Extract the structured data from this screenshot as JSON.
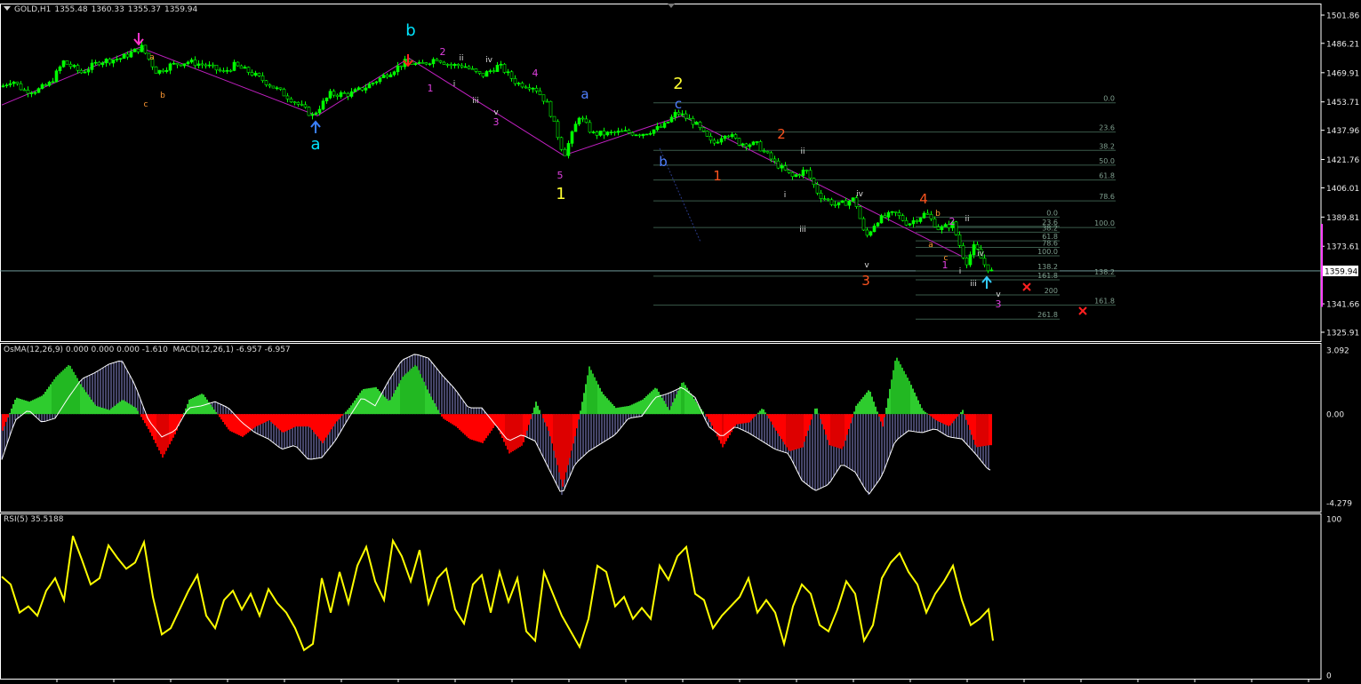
{
  "colors": {
    "background": "#000000",
    "grid_frame": "#ffffff",
    "candle_bull": "#00ff00",
    "candle_bear": "#00ff00",
    "fib_line": "#3a5a4a",
    "fib_text": "#7f9f8f",
    "macd_signal": "#ffffff",
    "histogram_hatch": "#8a8ad0",
    "osma_pos": "#2ecc2e",
    "osma_neg": "#ff0000",
    "rsi_line": "#ffff00",
    "wave_line": "#c020c0"
  },
  "header": {
    "symbol": "GOLD,H1",
    "open": "1355.48",
    "high": "1360.33",
    "low": "1355.37",
    "close": "1359.94"
  },
  "chart_data": [
    {
      "type": "candlestick",
      "title": "GOLD,H1",
      "ylim": [
        1325.91,
        1501.86
      ],
      "y_ticks": [
        "1501.86",
        "1486.21",
        "1469.91",
        "1453.71",
        "1437.96",
        "1421.76",
        "1406.01",
        "1389.81",
        "1373.61",
        "1359.94",
        "1341.66",
        "1325.91"
      ],
      "current_price": "1359.94",
      "price_path_x_index": [
        0,
        12,
        25,
        40,
        55,
        70,
        90,
        110,
        135,
        158,
        175,
        190,
        210,
        230,
        250,
        262,
        280,
        300,
        330,
        350,
        370,
        392,
        410,
        430,
        455,
        470,
        490,
        505,
        520,
        540,
        560,
        580,
        600,
        615,
        633,
        650,
        665,
        680,
        700,
        720,
        745,
        760,
        780,
        800,
        815,
        830,
        850,
        870,
        890,
        905,
        920,
        940,
        960,
        972,
        985,
        1005,
        1020,
        1040,
        1055,
        1070,
        1085,
        1095,
        1105,
        1115
      ],
      "price_path": [
        1462,
        1466,
        1460,
        1460,
        1464,
        1476,
        1470,
        1476,
        1478,
        1484,
        1470,
        1474,
        1476,
        1474,
        1470,
        1474,
        1470,
        1464,
        1454,
        1446,
        1458,
        1458,
        1462,
        1468,
        1476,
        1474,
        1478,
        1474,
        1474,
        1468,
        1474,
        1464,
        1462,
        1452,
        1424,
        1446,
        1436,
        1436,
        1437,
        1436,
        1440,
        1448,
        1442,
        1430,
        1437,
        1431,
        1430,
        1420,
        1412,
        1416,
        1402,
        1396,
        1400,
        1378,
        1388,
        1392,
        1386,
        1392,
        1383,
        1386,
        1364,
        1374,
        1364,
        1359
      ],
      "elliott_labels": [
        {
          "text": "a",
          "color": "#00e5ff",
          "size": "big"
        },
        {
          "text": "b",
          "color": "#00e5ff",
          "size": "big"
        },
        {
          "text": "1",
          "color": "#ffff33",
          "size": "big"
        },
        {
          "text": "2",
          "color": "#ffff33",
          "size": "big"
        },
        {
          "text": "a",
          "color": "#4f7fff",
          "size": "mid"
        },
        {
          "text": "b",
          "color": "#4f7fff",
          "size": "mid"
        },
        {
          "text": "c",
          "color": "#4f7fff",
          "size": "mid"
        },
        {
          "text": "1",
          "color": "#ff5520",
          "size": "mid"
        },
        {
          "text": "2",
          "color": "#ff5520",
          "size": "mid"
        },
        {
          "text": "3",
          "color": "#ff5520",
          "size": "mid"
        },
        {
          "text": "4",
          "color": "#ff5520",
          "size": "mid"
        },
        {
          "text": "1",
          "color": "#e040e0",
          "size": "small"
        },
        {
          "text": "2",
          "color": "#e040e0",
          "size": "small"
        },
        {
          "text": "3",
          "color": "#e040e0",
          "size": "small"
        },
        {
          "text": "4",
          "color": "#e040e0",
          "size": "small"
        },
        {
          "text": "5",
          "color": "#e040e0",
          "size": "small"
        },
        {
          "text": "1",
          "color": "#e040e0",
          "size": "small"
        },
        {
          "text": "2",
          "color": "#e040e0",
          "size": "small"
        },
        {
          "text": "3",
          "color": "#e040e0",
          "size": "small"
        },
        {
          "text": "a",
          "color": "#ff9933",
          "size": "tiny"
        },
        {
          "text": "b",
          "color": "#ff9933",
          "size": "tiny"
        },
        {
          "text": "c",
          "color": "#ff9933",
          "size": "tiny"
        },
        {
          "text": "a",
          "color": "#ff9933",
          "size": "tiny"
        },
        {
          "text": "b",
          "color": "#ff9933",
          "size": "tiny"
        },
        {
          "text": "c",
          "color": "#ff9933",
          "size": "tiny"
        },
        {
          "text": "i",
          "color": "#dddddd",
          "size": "tiny"
        },
        {
          "text": "ii",
          "color": "#dddddd",
          "size": "tiny"
        },
        {
          "text": "iii",
          "color": "#dddddd",
          "size": "tiny"
        },
        {
          "text": "iv",
          "color": "#dddddd",
          "size": "tiny"
        },
        {
          "text": "v",
          "color": "#dddddd",
          "size": "tiny"
        },
        {
          "text": "i",
          "color": "#dddddd",
          "size": "tiny"
        },
        {
          "text": "ii",
          "color": "#dddddd",
          "size": "tiny"
        },
        {
          "text": "iii",
          "color": "#dddddd",
          "size": "tiny"
        },
        {
          "text": "iv",
          "color": "#dddddd",
          "size": "tiny"
        },
        {
          "text": "v",
          "color": "#dddddd",
          "size": "tiny"
        },
        {
          "text": "i",
          "color": "#dddddd",
          "size": "tiny"
        },
        {
          "text": "ii",
          "color": "#dddddd",
          "size": "tiny"
        },
        {
          "text": "iii",
          "color": "#dddddd",
          "size": "tiny"
        },
        {
          "text": "iv",
          "color": "#dddddd",
          "size": "tiny"
        },
        {
          "text": "v",
          "color": "#dddddd",
          "size": "tiny"
        }
      ],
      "fib_big": [
        {
          "label": "0.0",
          "price": 1453.2
        },
        {
          "label": "23.6",
          "price": 1437.0
        },
        {
          "label": "38.2",
          "price": 1426.8
        },
        {
          "label": "50.0",
          "price": 1418.6
        },
        {
          "label": "61.8",
          "price": 1410.4
        },
        {
          "label": "78.6",
          "price": 1398.8
        },
        {
          "label": "100.0",
          "price": 1384.0
        },
        {
          "label": "138.2",
          "price": 1357.0
        },
        {
          "label": "161.8",
          "price": 1341.0
        }
      ],
      "fib_small": [
        {
          "label": "0.0",
          "price": 1389.8
        },
        {
          "label": "23.6",
          "price": 1384.6
        },
        {
          "label": "38.2",
          "price": 1381.4
        },
        {
          "label": "61.8",
          "price": 1376.6
        },
        {
          "label": "78.6",
          "price": 1373.0
        },
        {
          "label": "100.0",
          "price": 1368.3
        },
        {
          "label": "138.2",
          "price": 1360.0
        },
        {
          "label": "161.8",
          "price": 1355.0
        },
        {
          "label": "200",
          "price": 1346.6
        },
        {
          "label": "261.8",
          "price": 1333.2
        }
      ]
    },
    {
      "type": "histogram",
      "title": "OsMA(12,26,9) 0.000 0.000 0.000 -1.610  MACD(12,26,1) -6.957 -6.957",
      "ylim": [
        -4.279,
        3.092
      ],
      "y_ticks": [
        "3.092",
        "0.00",
        "-4.279"
      ],
      "osma_x_index": [
        0,
        15,
        30,
        45,
        60,
        75,
        90,
        105,
        120,
        135,
        150,
        165,
        180,
        195,
        210,
        225,
        240,
        255,
        270,
        285,
        300,
        315,
        330,
        345,
        360,
        375,
        390,
        405,
        420,
        435,
        450,
        465,
        480,
        495,
        510,
        525,
        540,
        555,
        570,
        585,
        600,
        615,
        630,
        645,
        660,
        675,
        690,
        705,
        720,
        735,
        750,
        765,
        780,
        795,
        810,
        825,
        840,
        855,
        870,
        885,
        900,
        915,
        930,
        945,
        960,
        975,
        990,
        1005,
        1020,
        1035,
        1050,
        1065,
        1080,
        1095,
        1110
      ],
      "osma_values": [
        -0.8,
        0.8,
        0.6,
        0.9,
        1.8,
        2.4,
        1.3,
        0.4,
        0.2,
        0.7,
        0.3,
        -0.8,
        -2.1,
        -0.9,
        0.7,
        1.0,
        0.1,
        -0.8,
        -1.1,
        -0.6,
        -0.3,
        -0.9,
        -0.6,
        -0.6,
        -1.4,
        -0.4,
        0.3,
        1.2,
        1.3,
        0.6,
        1.8,
        2.4,
        1.0,
        -0.2,
        -0.6,
        -1.2,
        -1.4,
        -0.5,
        -1.9,
        -1.5,
        0.6,
        -0.9,
        -3.5,
        -0.9,
        2.3,
        1.0,
        0.3,
        0.4,
        0.7,
        1.3,
        0.2,
        1.6,
        0.6,
        -0.3,
        -1.6,
        -0.5,
        -0.4,
        0.3,
        -0.8,
        -1.8,
        -1.6,
        0.4,
        -1.5,
        -1.7,
        0.4,
        1.2,
        -0.6,
        2.8,
        1.6,
        0.2,
        -0.3,
        -0.6,
        0.2,
        -1.6,
        -1.5
      ],
      "macd_values": [
        -2.2,
        -0.3,
        0.2,
        -0.4,
        -0.2,
        0.8,
        1.7,
        2.0,
        2.4,
        2.6,
        1.4,
        -0.3,
        -1.1,
        -0.8,
        0.3,
        0.4,
        0.6,
        0.3,
        -0.4,
        -0.9,
        -1.2,
        -1.7,
        -1.5,
        -2.2,
        -2.1,
        -1.3,
        -0.2,
        0.8,
        0.4,
        1.6,
        2.6,
        2.9,
        2.7,
        1.9,
        1.2,
        0.3,
        0.3,
        -0.5,
        -1.3,
        -1.0,
        -1.3,
        -2.6,
        -3.9,
        -2.4,
        -1.8,
        -1.4,
        -1.0,
        -0.2,
        -0.1,
        0.8,
        1.0,
        1.3,
        0.8,
        -0.6,
        -1.1,
        -0.6,
        -0.9,
        -1.3,
        -1.7,
        -1.9,
        -3.2,
        -3.7,
        -3.4,
        -2.4,
        -2.8,
        -3.9,
        -3.0,
        -1.3,
        -0.8,
        -0.9,
        -0.7,
        -1.1,
        -1.2,
        -1.9,
        -2.7
      ]
    },
    {
      "type": "line",
      "title": "RSI(5) 35.5188",
      "ylim": [
        0,
        100
      ],
      "y_ticks": [
        "100",
        "0"
      ],
      "x_index": [
        0,
        10,
        20,
        30,
        40,
        50,
        60,
        70,
        80,
        90,
        100,
        110,
        120,
        130,
        140,
        150,
        160,
        170,
        180,
        190,
        200,
        210,
        220,
        230,
        240,
        250,
        260,
        270,
        280,
        290,
        300,
        310,
        320,
        330,
        340,
        350,
        360,
        370,
        380,
        390,
        400,
        410,
        420,
        430,
        440,
        450,
        460,
        470,
        480,
        490,
        500,
        510,
        520,
        530,
        540,
        550,
        560,
        570,
        580,
        590,
        600,
        610,
        620,
        630,
        640,
        650,
        660,
        670,
        680,
        690,
        700,
        710,
        720,
        730,
        740,
        750,
        760,
        770,
        780,
        790,
        800,
        810,
        820,
        830,
        840,
        850,
        860,
        870,
        880,
        890,
        900,
        910,
        920,
        930,
        940,
        950,
        960,
        970,
        980,
        990,
        1000,
        1010,
        1020,
        1030,
        1040,
        1050,
        1060,
        1070,
        1080,
        1090,
        1100,
        1110,
        1115
      ],
      "values": [
        63,
        58,
        40,
        44,
        38,
        54,
        62,
        48,
        89,
        74,
        58,
        62,
        83,
        75,
        68,
        72,
        85,
        50,
        26,
        30,
        42,
        54,
        64,
        38,
        30,
        48,
        54,
        42,
        52,
        38,
        55,
        46,
        40,
        30,
        16,
        20,
        62,
        40,
        66,
        46,
        70,
        82,
        60,
        48,
        86,
        76,
        60,
        80,
        46,
        62,
        68,
        42,
        33,
        58,
        64,
        40,
        66,
        47,
        62,
        28,
        22,
        66,
        52,
        38,
        28,
        18,
        36,
        70,
        66,
        44,
        50,
        36,
        43,
        36,
        70,
        61,
        76,
        82,
        52,
        48,
        30,
        38,
        44,
        50,
        62,
        40,
        48,
        40,
        20,
        44,
        58,
        52,
        32,
        28,
        42,
        60,
        52,
        22,
        32,
        62,
        72,
        78,
        66,
        58,
        40,
        52,
        60,
        70,
        48,
        32,
        36,
        42,
        22,
        34,
        42
      ]
    }
  ]
}
